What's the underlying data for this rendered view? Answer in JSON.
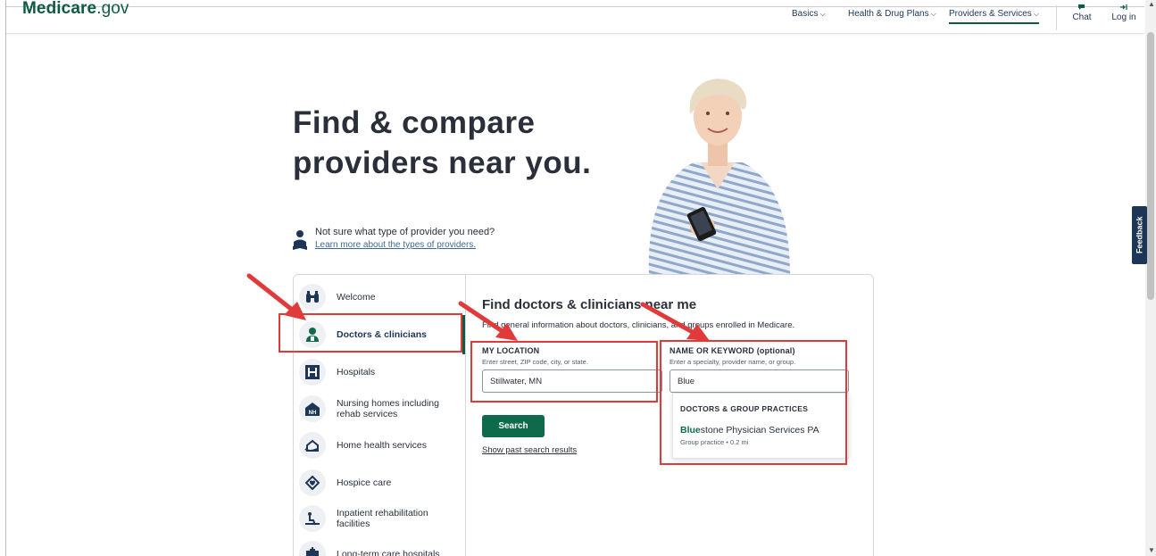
{
  "header": {
    "logo_brand": "Medicare",
    "logo_tld": ".gov",
    "nav": [
      {
        "label": "Basics",
        "active": false
      },
      {
        "label": "Health & Drug Plans",
        "active": false
      },
      {
        "label": "Providers & Services",
        "active": true
      }
    ],
    "chat_label": "Chat",
    "login_label": "Log in"
  },
  "feedback_label": "Feedback",
  "hero": {
    "title_line1": "Find & compare",
    "title_line2": "providers near you."
  },
  "helper": {
    "question": "Not sure what type of provider you need?",
    "link": "Learn more about the types of providers."
  },
  "sidebar": {
    "items": [
      {
        "label": "Welcome",
        "icon": "binoculars-icon"
      },
      {
        "label": "Doctors & clinicians",
        "icon": "doctor-icon",
        "active": true
      },
      {
        "label": "Hospitals",
        "icon": "hospital-h-icon"
      },
      {
        "label": "Nursing homes including rehab services",
        "label_line1": "Nursing homes including",
        "label_line2": "rehab services",
        "icon": "nursing-home-icon"
      },
      {
        "label": "Home health services",
        "icon": "home-health-icon"
      },
      {
        "label": "Hospice care",
        "icon": "hospice-icon"
      },
      {
        "label": "Inpatient rehabilitation facilities",
        "label_line1": "Inpatient rehabilitation",
        "label_line2": "facilities",
        "icon": "rehab-icon"
      },
      {
        "label": "Long-term care hospitals",
        "icon": "ltc-hospital-icon"
      }
    ]
  },
  "content": {
    "title": "Find doctors & clinicians near me",
    "subtitle": "Find general information about doctors, clinicians, and groups enrolled in Medicare.",
    "location": {
      "label": "MY LOCATION",
      "hint": "Enter street, ZIP code, city, or state.",
      "value": "Stillwater, MN"
    },
    "keyword": {
      "label": "NAME OR KEYWORD (optional)",
      "hint": "Enter a specialty, provider name, or group.",
      "value": "Blue"
    },
    "search_label": "Search",
    "past_results_link": "Show past search results"
  },
  "dropdown": {
    "heading": "DOCTORS & GROUP PRACTICES",
    "result_match": "Blue",
    "result_rest": "stone Physician Services PA",
    "result_meta": "Group practice • 0.2 mi"
  },
  "colors": {
    "brand_green": "#0d5c3f",
    "button_green": "#0d6b4c",
    "navy": "#1d3557",
    "annotation_red": "#e03a3a"
  }
}
